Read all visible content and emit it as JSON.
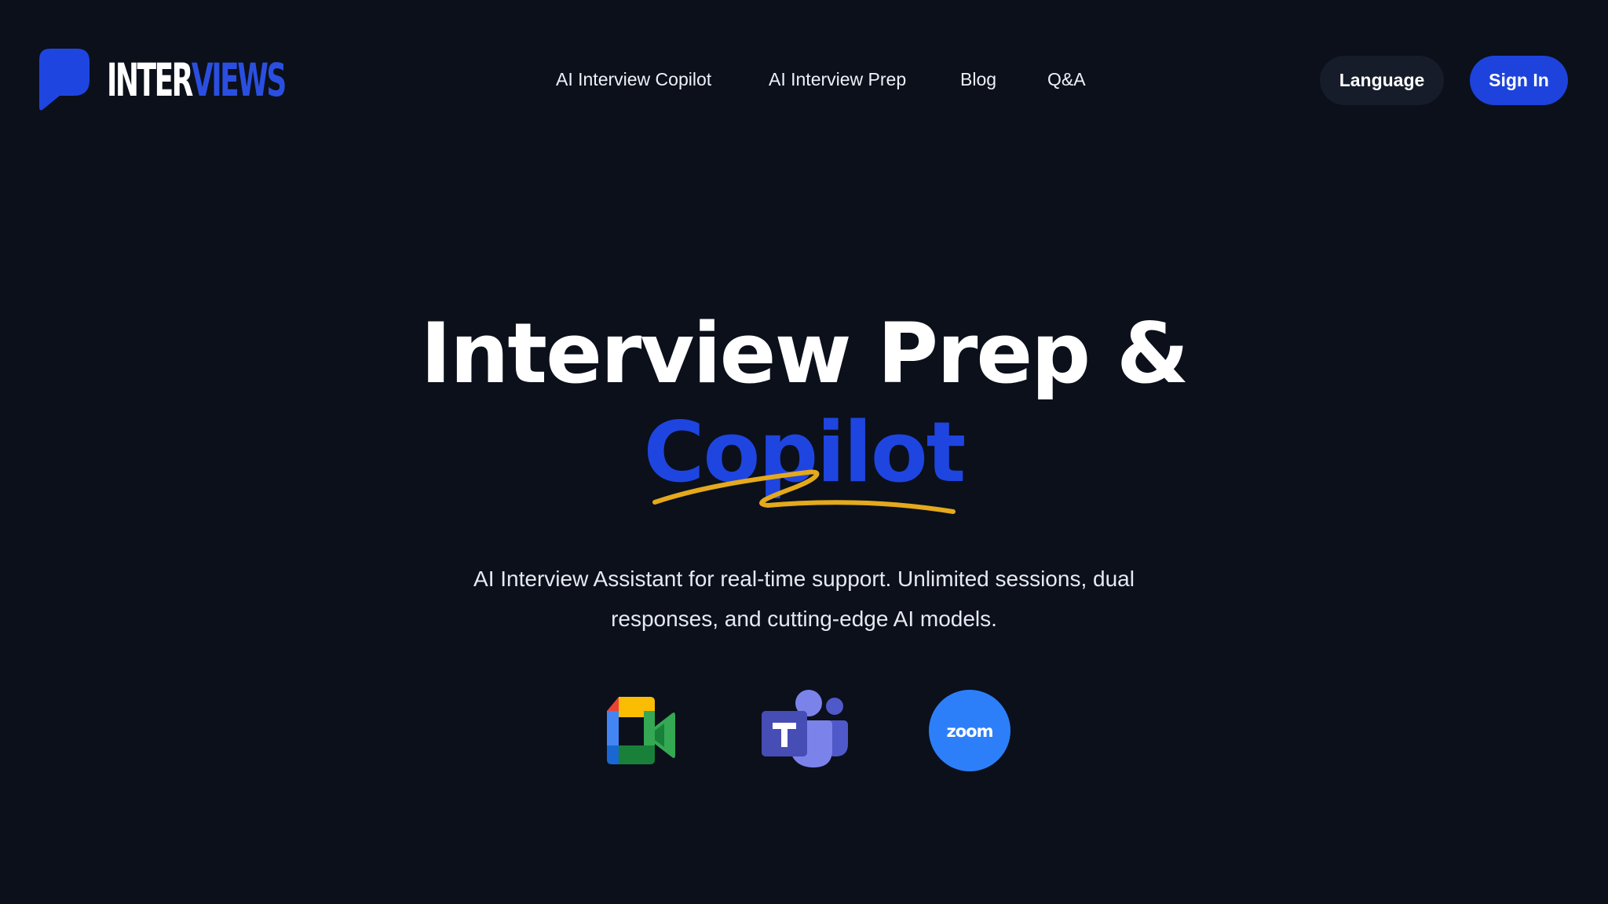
{
  "brand": {
    "name_part1": "INTER",
    "name_part2": "VIEWS",
    "icon": "speech-bubble-logo-icon",
    "accent_color": "#1f45e0"
  },
  "nav": {
    "items": [
      {
        "label": "AI Interview Copilot"
      },
      {
        "label": "AI Interview Prep"
      },
      {
        "label": "Blog"
      },
      {
        "label": "Q&A"
      }
    ]
  },
  "header_actions": {
    "language_label": "Language",
    "signin_label": "Sign In"
  },
  "hero": {
    "title_line1": "Interview Prep &",
    "title_line2": "Copilot",
    "subtitle": "AI Interview Assistant for real-time support. Unlimited sessions, dual responses, and cutting-edge AI models.",
    "underline_color": "#e4a91c"
  },
  "platforms": [
    {
      "icon": "google-meet-icon"
    },
    {
      "icon": "microsoft-teams-icon"
    },
    {
      "icon": "zoom-icon",
      "label": "zoom"
    }
  ],
  "colors": {
    "background": "#0b101b",
    "primary_button": "#1d43dc",
    "secondary_button": "#161c29"
  }
}
